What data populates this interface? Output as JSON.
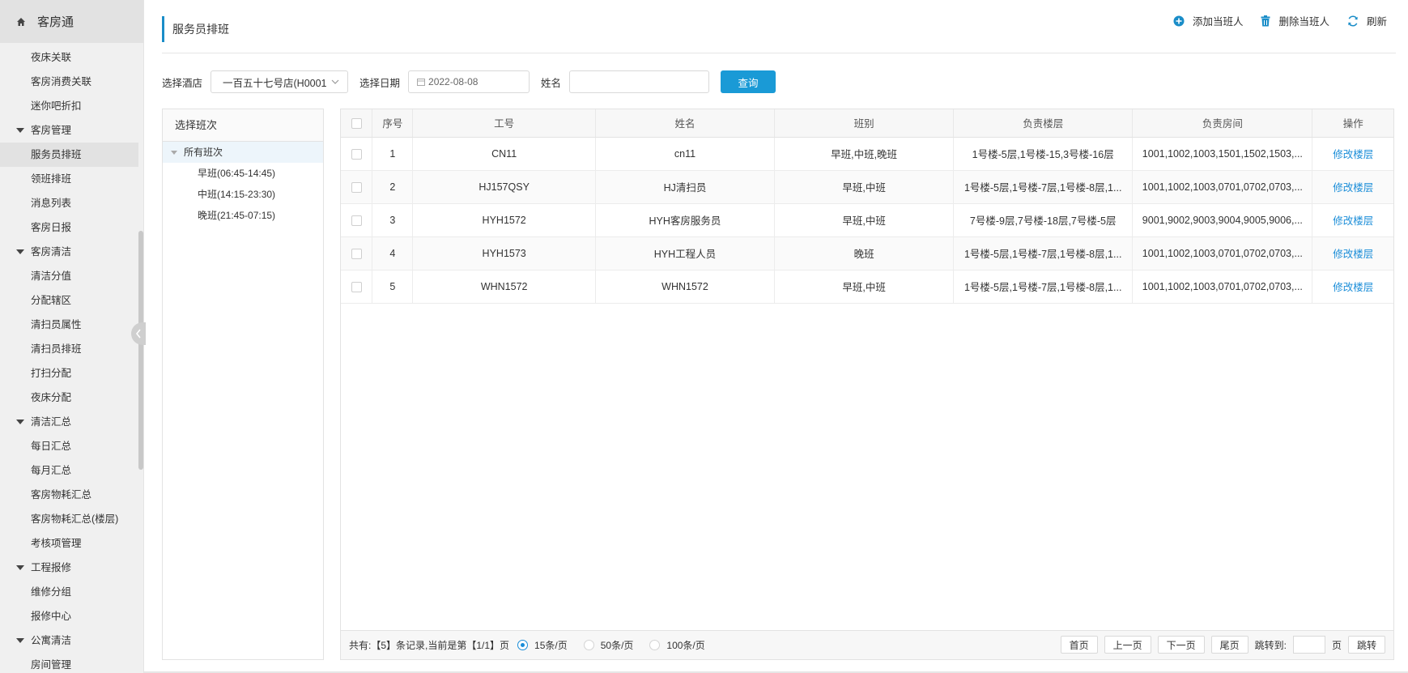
{
  "app": {
    "title": "客房通"
  },
  "sidebar": {
    "items": [
      {
        "label": "夜床关联",
        "type": "item"
      },
      {
        "label": "客房消费关联",
        "type": "item"
      },
      {
        "label": "迷你吧折扣",
        "type": "item"
      },
      {
        "label": "客房管理",
        "type": "group"
      },
      {
        "label": "服务员排班",
        "type": "item",
        "active": true
      },
      {
        "label": "领班排班",
        "type": "item"
      },
      {
        "label": "消息列表",
        "type": "item"
      },
      {
        "label": "客房日报",
        "type": "item"
      },
      {
        "label": "客房清洁",
        "type": "group"
      },
      {
        "label": "清洁分值",
        "type": "item"
      },
      {
        "label": "分配辖区",
        "type": "item"
      },
      {
        "label": "清扫员属性",
        "type": "item"
      },
      {
        "label": "清扫员排班",
        "type": "item"
      },
      {
        "label": "打扫分配",
        "type": "item"
      },
      {
        "label": "夜床分配",
        "type": "item"
      },
      {
        "label": "清洁汇总",
        "type": "group"
      },
      {
        "label": "每日汇总",
        "type": "item"
      },
      {
        "label": "每月汇总",
        "type": "item"
      },
      {
        "label": "客房物耗汇总",
        "type": "item"
      },
      {
        "label": "客房物耗汇总(楼层)",
        "type": "item"
      },
      {
        "label": "考核项管理",
        "type": "item"
      },
      {
        "label": "工程报修",
        "type": "group"
      },
      {
        "label": "维修分组",
        "type": "item"
      },
      {
        "label": "报修中心",
        "type": "item"
      },
      {
        "label": "公寓清洁",
        "type": "group"
      },
      {
        "label": "房间管理",
        "type": "item"
      }
    ]
  },
  "page": {
    "title": "服务员排班"
  },
  "toolbar": {
    "add_label": "添加当班人",
    "delete_label": "删除当班人",
    "refresh_label": "刷新"
  },
  "filter": {
    "hotel_label": "选择酒店",
    "hotel_value": "一百五十七号店(H0001",
    "date_label": "选择日期",
    "date_value": "2022-08-08",
    "name_label": "姓名",
    "name_value": "",
    "query_label": "查询"
  },
  "shifts": {
    "title": "选择班次",
    "root": "所有班次",
    "children": [
      "早班(06:45-14:45)",
      "中班(14:15-23:30)",
      "晚班(21:45-07:15)"
    ]
  },
  "table": {
    "headers": [
      "序号",
      "工号",
      "姓名",
      "班别",
      "负责楼层",
      "负责房间",
      "操作"
    ],
    "rows": [
      {
        "no": "1",
        "id": "CN11",
        "name": "cn11",
        "shift": "早班,中班,晚班",
        "floors": "1号楼-5层,1号楼-15,3号楼-16层",
        "rooms": "1001,1002,1003,1501,1502,1503,...",
        "op": "修改楼层"
      },
      {
        "no": "2",
        "id": "HJ157QSY",
        "name": "HJ清扫员",
        "shift": "早班,中班",
        "floors": "1号楼-5层,1号楼-7层,1号楼-8层,1...",
        "rooms": "1001,1002,1003,0701,0702,0703,...",
        "op": "修改楼层"
      },
      {
        "no": "3",
        "id": "HYH1572",
        "name": "HYH客房服务员",
        "shift": "早班,中班",
        "floors": "7号楼-9层,7号楼-18层,7号楼-5层",
        "rooms": "9001,9002,9003,9004,9005,9006,...",
        "op": "修改楼层"
      },
      {
        "no": "4",
        "id": "HYH1573",
        "name": "HYH工程人员",
        "shift": "晚班",
        "floors": "1号楼-5层,1号楼-7层,1号楼-8层,1...",
        "rooms": "1001,1002,1003,0701,0702,0703,...",
        "op": "修改楼层"
      },
      {
        "no": "5",
        "id": "WHN1572",
        "name": "WHN1572",
        "shift": "早班,中班",
        "floors": "1号楼-5层,1号楼-7层,1号楼-8层,1...",
        "rooms": "1001,1002,1003,0701,0702,0703,...",
        "op": "修改楼层"
      }
    ]
  },
  "pager": {
    "summary": "共有:【5】条记录,当前是第【1/1】页",
    "size_options": [
      "15条/页",
      "50条/页",
      "100条/页"
    ],
    "selected_size": "15条/页",
    "first": "首页",
    "prev": "上一页",
    "next": "下一页",
    "last": "尾页",
    "jump_label": "跳转到:",
    "page_unit": "页",
    "jump_btn": "跳转"
  },
  "colors": {
    "accent": "#1a9ad6",
    "link": "#1a8dd8"
  }
}
